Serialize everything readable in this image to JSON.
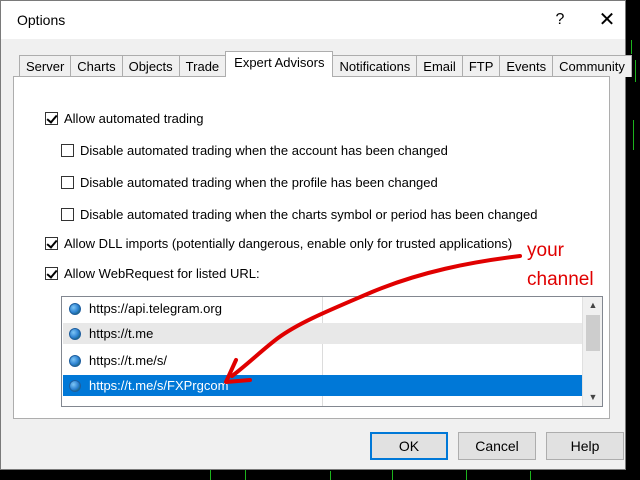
{
  "window": {
    "title": "Options",
    "help_glyph": "?",
    "close_glyph": "✕"
  },
  "tabs": [
    {
      "label": "Server"
    },
    {
      "label": "Charts"
    },
    {
      "label": "Objects"
    },
    {
      "label": "Trade"
    },
    {
      "label": "Expert Advisors",
      "active": true
    },
    {
      "label": "Notifications"
    },
    {
      "label": "Email"
    },
    {
      "label": "FTP"
    },
    {
      "label": "Events"
    },
    {
      "label": "Community"
    }
  ],
  "options": {
    "allow_automated_trading": {
      "label": "Allow automated trading",
      "checked": true
    },
    "disable_on_account_change": {
      "label": "Disable automated trading when the account has been changed",
      "checked": false
    },
    "disable_on_profile_change": {
      "label": "Disable automated trading when the profile has been changed",
      "checked": false
    },
    "disable_on_symbol_change": {
      "label": "Disable automated trading when the charts symbol or period has been changed",
      "checked": false
    },
    "allow_dll_imports": {
      "label": "Allow DLL imports (potentially dangerous, enable only for trusted applications)",
      "checked": true
    },
    "allow_webrequest": {
      "label": "Allow WebRequest for listed URL:",
      "checked": true
    }
  },
  "url_list": {
    "items": [
      {
        "url": "https://api.telegram.org",
        "selected": false
      },
      {
        "url": "https://t.me",
        "selected": false
      },
      {
        "url": "https://t.me/s/",
        "selected": false
      },
      {
        "url": "https://t.me/s/FXPrgcom",
        "selected": true
      }
    ],
    "scroll_up_glyph": "▲",
    "scroll_down_glyph": "▼"
  },
  "buttons": {
    "ok": "OK",
    "cancel": "Cancel",
    "help": "Help"
  },
  "annotation": {
    "line1": "your",
    "line2": "channel",
    "color": "#e00000"
  },
  "colors": {
    "selection": "#0078d7",
    "chart_bars": "#1db31d"
  }
}
